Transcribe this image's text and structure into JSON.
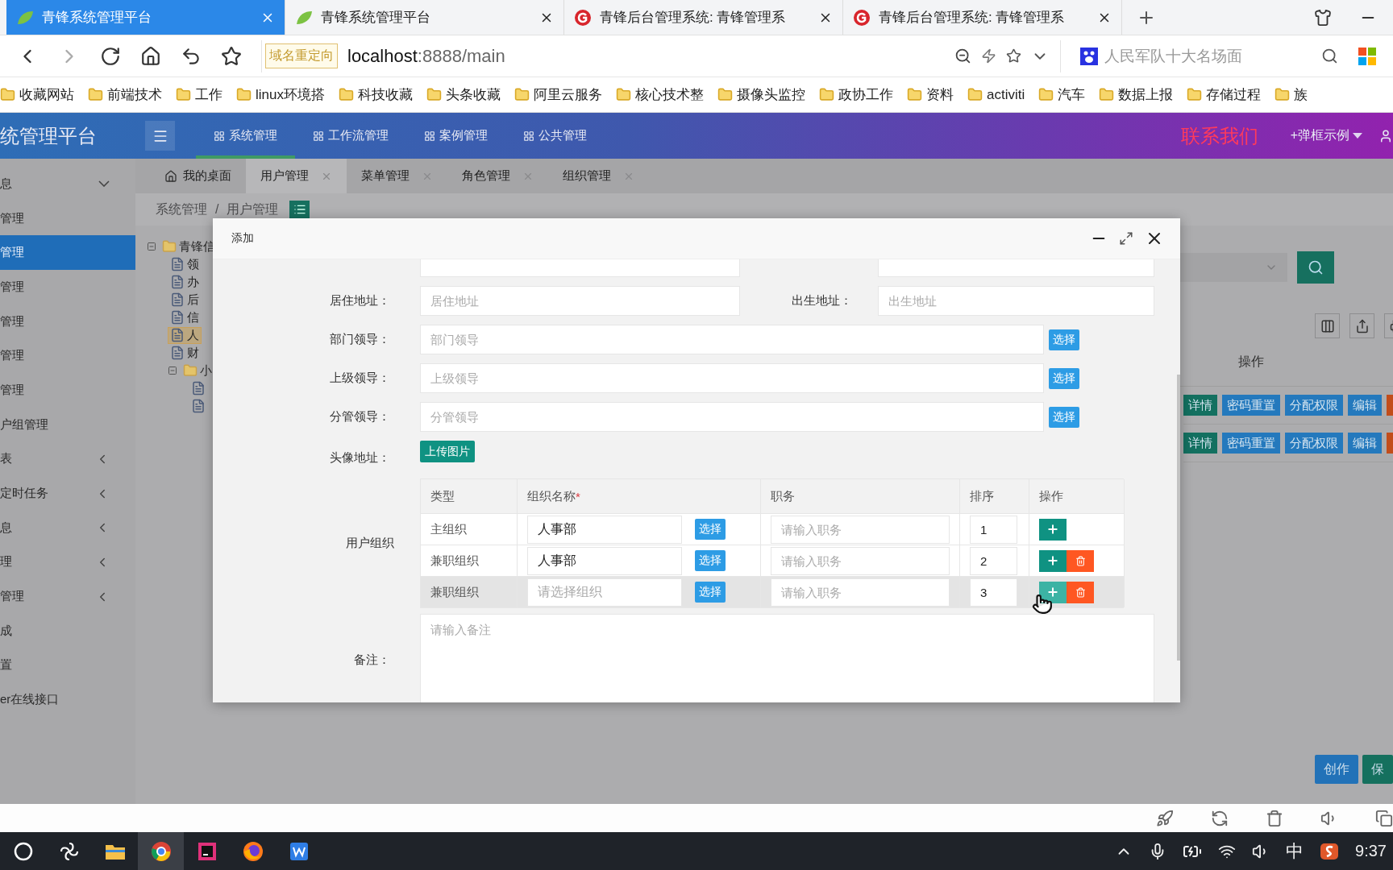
{
  "browser": {
    "tabs": [
      {
        "title": "青锋系统管理平台",
        "kind": "leaf",
        "selected": true
      },
      {
        "title": "青锋系统管理平台",
        "kind": "leaf",
        "selected": false
      },
      {
        "title": "青锋后台管理系统: 青锋管理系",
        "kind": "badge",
        "selected": false
      },
      {
        "title": "青锋后台管理系统: 青锋管理系",
        "kind": "badge",
        "selected": false
      }
    ],
    "redirect_badge": "域名重定向",
    "url_host": "localhost",
    "url_path": ":8888/main",
    "search_placeholder": "人民军队十大名场面",
    "bookmarks": [
      "收藏网站",
      "前端技术",
      "工作",
      "linux环境搭",
      "科技收藏",
      "头条收藏",
      "阿里云服务",
      "核心技术整",
      "摄像头监控",
      "政协工作",
      "资料",
      "activiti",
      "汽车",
      "数据上报",
      "存储过程",
      "族"
    ]
  },
  "app": {
    "title": "统管理平台",
    "nav": [
      {
        "label": "系统管理",
        "selected": true
      },
      {
        "label": "工作流管理",
        "selected": false
      },
      {
        "label": "案例管理",
        "selected": false
      },
      {
        "label": "公共管理",
        "selected": false
      }
    ],
    "contact": "联系我们",
    "dialog_menu": "+弹框示例"
  },
  "sidebar": {
    "items": [
      {
        "label": "息",
        "kind": "group",
        "expanded": true,
        "selected": false
      },
      {
        "label": "管理",
        "kind": "link",
        "selected": false
      },
      {
        "label": "管理",
        "kind": "link",
        "selected": true
      },
      {
        "label": "管理",
        "kind": "link",
        "selected": false
      },
      {
        "label": "管理",
        "kind": "link",
        "selected": false
      },
      {
        "label": "管理",
        "kind": "link",
        "selected": false
      },
      {
        "label": "管理",
        "kind": "link",
        "selected": false
      },
      {
        "label": "户组管理",
        "kind": "link",
        "selected": false
      },
      {
        "label": "表",
        "kind": "group",
        "expanded": false,
        "selected": false
      },
      {
        "label": "定时任务",
        "kind": "group",
        "expanded": false,
        "selected": false
      },
      {
        "label": "息",
        "kind": "group",
        "expanded": false,
        "selected": false
      },
      {
        "label": "理",
        "kind": "group",
        "expanded": false,
        "selected": false
      },
      {
        "label": "管理",
        "kind": "group",
        "expanded": false,
        "selected": false
      },
      {
        "label": "成",
        "kind": "link",
        "selected": false
      },
      {
        "label": "置",
        "kind": "link",
        "selected": false
      },
      {
        "label": "er在线接口",
        "kind": "link",
        "selected": false
      }
    ]
  },
  "page_tabs": [
    {
      "label": "我的桌面",
      "kind": "home",
      "selected": false
    },
    {
      "label": "用户管理",
      "kind": "closable",
      "selected": true
    },
    {
      "label": "菜单管理",
      "kind": "closable",
      "selected": false
    },
    {
      "label": "角色管理",
      "kind": "closable",
      "selected": false
    },
    {
      "label": "组织管理",
      "kind": "closable",
      "selected": false
    }
  ],
  "breadcrumb": {
    "items": [
      "系统管理",
      "用户管理"
    ],
    "separator": "/"
  },
  "tree": {
    "label": "青锋信",
    "kind": "folder",
    "expanded": true,
    "children": [
      {
        "label": "领",
        "kind": "file",
        "selected": false
      },
      {
        "label": "办",
        "kind": "file",
        "selected": false
      },
      {
        "label": "后",
        "kind": "file",
        "selected": false
      },
      {
        "label": "信",
        "kind": "file",
        "selected": false
      },
      {
        "label": "人",
        "kind": "file",
        "selected": true
      },
      {
        "label": "财",
        "kind": "file",
        "selected": false
      },
      {
        "label": "小",
        "kind": "folder",
        "expanded": true,
        "selected": false,
        "children": [
          {
            "kind": "file",
            "selected": false
          },
          {
            "kind": "file",
            "selected": false
          }
        ]
      }
    ]
  },
  "user_table": {
    "action_header": "操作",
    "rows": [
      [
        {
          "label": "详情",
          "kind": "info"
        },
        {
          "label": "密码重置",
          "kind": "normal"
        },
        {
          "label": "分配权限",
          "kind": "normal"
        },
        {
          "label": "编辑",
          "kind": "normal"
        },
        {
          "kind": "danger"
        }
      ],
      [
        {
          "label": "详情",
          "kind": "info"
        },
        {
          "label": "密码重置",
          "kind": "normal"
        },
        {
          "label": "分配权限",
          "kind": "normal"
        },
        {
          "label": "编辑",
          "kind": "normal"
        },
        {
          "kind": "danger"
        }
      ]
    ]
  },
  "footer_buttons": [
    {
      "label": "创作",
      "kind": "normal"
    },
    {
      "label": "保",
      "kind": "info"
    }
  ],
  "modal": {
    "title": "添加",
    "rows": [
      {
        "kind": "cut_pair"
      },
      {
        "kind": "pair",
        "items": [
          {
            "label": "居住地址：",
            "placeholder": "居住地址"
          },
          {
            "label": "出生地址：",
            "placeholder": "出生地址"
          }
        ]
      },
      {
        "kind": "picker",
        "label": "部门领导：",
        "placeholder": "部门领导",
        "button": "选择"
      },
      {
        "kind": "picker",
        "label": "上级领导：",
        "placeholder": "上级领导",
        "button": "选择"
      },
      {
        "kind": "picker",
        "label": "分管领导：",
        "placeholder": "分管领导",
        "button": "选择"
      },
      {
        "kind": "upload",
        "label": "头像地址：",
        "button": "上传图片"
      }
    ],
    "org": {
      "label": "用户组织",
      "columns": [
        {
          "label": "类型"
        },
        {
          "label": "组织名称",
          "required_mark": "*"
        },
        {
          "label": "职务"
        },
        {
          "label": "排序"
        },
        {
          "label": "操作"
        }
      ],
      "rows": [
        {
          "type": "主组织",
          "org": "人事部",
          "pick": "选择",
          "duty_placeholder": "请输入职务",
          "order": "1",
          "deletable": false,
          "hovered": false
        },
        {
          "type": "兼职组织",
          "org": "人事部",
          "pick": "选择",
          "duty_placeholder": "请输入职务",
          "order": "2",
          "deletable": true,
          "hovered": false
        },
        {
          "type": "兼职组织",
          "org_placeholder": "请选择组织",
          "pick": "选择",
          "duty_placeholder": "请输入职务",
          "order": "3",
          "deletable": true,
          "hovered": true
        }
      ]
    },
    "remark": {
      "label": "备注：",
      "placeholder": "请输入备注"
    }
  },
  "taskbar": {
    "apps": [
      {
        "kind": "swirl",
        "selected": false
      },
      {
        "kind": "files",
        "selected": false
      },
      {
        "kind": "chrome",
        "selected": true
      },
      {
        "kind": "ide",
        "selected": false
      },
      {
        "kind": "firefox",
        "selected": false
      },
      {
        "kind": "writer",
        "selected": false
      }
    ],
    "ime": "中",
    "time": "9:37"
  }
}
